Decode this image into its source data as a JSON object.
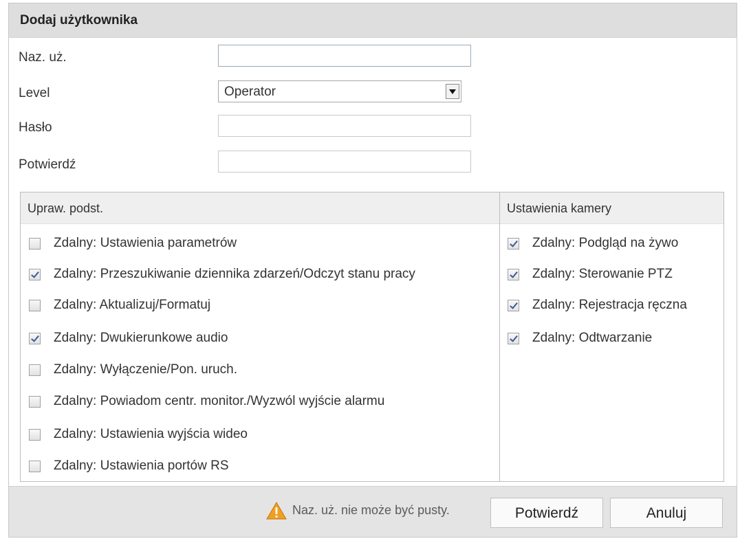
{
  "dialog": {
    "title": "Dodaj użytkownika"
  },
  "form": {
    "username_label": "Naz. uż.",
    "username_value": "",
    "level_label": "Level",
    "level_value": "Operator",
    "password_label": "Hasło",
    "password_value": "",
    "confirm_label": "Potwierdź",
    "confirm_value": ""
  },
  "permissions": {
    "basic_header": "Upraw. podst.",
    "camera_header": "Ustawienia kamery",
    "basic": [
      {
        "label": "Zdalny: Ustawienia parametrów",
        "checked": false
      },
      {
        "label": "Zdalny: Przeszukiwanie dziennika zdarzeń/Odczyt stanu pracy",
        "checked": true
      },
      {
        "label": "Zdalny: Aktualizuj/Formatuj",
        "checked": false
      },
      {
        "label": "Zdalny: Dwukierunkowe audio",
        "checked": true
      },
      {
        "label": "Zdalny: Wyłączenie/Pon. uruch.",
        "checked": false
      },
      {
        "label": "Zdalny: Powiadom centr. monitor./Wyzwól wyjście alarmu",
        "checked": false
      },
      {
        "label": "Zdalny: Ustawienia wyjścia wideo",
        "checked": false
      },
      {
        "label": "Zdalny: Ustawienia portów RS",
        "checked": false
      }
    ],
    "camera": [
      {
        "label": "Zdalny: Podgląd na żywo",
        "checked": true
      },
      {
        "label": "Zdalny: Sterowanie PTZ",
        "checked": true
      },
      {
        "label": "Zdalny: Rejestracja ręczna",
        "checked": true
      },
      {
        "label": "Zdalny: Odtwarzanie",
        "checked": true
      }
    ]
  },
  "footer": {
    "warning_icon": "warning-triangle-icon",
    "warning_color": "#f0a020",
    "warning_text": "Naz. uż. nie może być pusty.",
    "confirm_button": "Potwierdź",
    "cancel_button": "Anuluj"
  }
}
